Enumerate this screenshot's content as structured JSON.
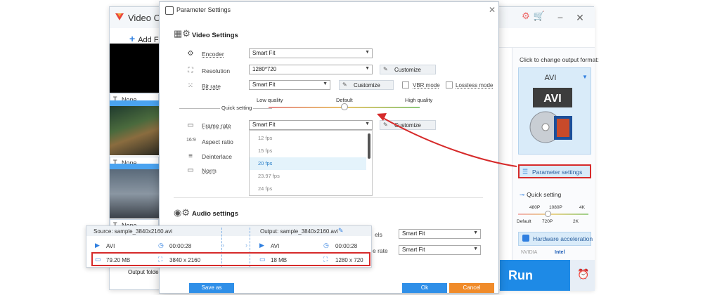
{
  "app": {
    "title": "Video Conv",
    "add_files": "Add File",
    "subtitle_rows": [
      {
        "icon": "T",
        "value": "None"
      },
      {
        "icon": "T",
        "value": "None"
      },
      {
        "icon": "T",
        "value": "None"
      }
    ],
    "output_folder_label": "Output folder:"
  },
  "right_panel": {
    "hint": "Click to change output format:",
    "format": "AVI",
    "format_badge": "AVI",
    "param_settings": "Parameter settings",
    "quick_setting": "Quick setting",
    "ticks_top": [
      "480P",
      "1080P",
      "4K"
    ],
    "ticks_bottom": [
      "Default",
      "720P",
      "2K"
    ],
    "hw_accel": "Hardware acceleration",
    "vendors": [
      "NVIDIA",
      "Intel"
    ],
    "run": "Run"
  },
  "dialog": {
    "title": "Parameter Settings",
    "video_section": "Video Settings",
    "audio_section": "Audio settings",
    "rows": {
      "encoder": {
        "label": "Encoder",
        "value": "Smart Fit"
      },
      "resolution": {
        "label": "Resolution",
        "value": "1280*720",
        "customize": "Customize"
      },
      "bitrate": {
        "label": "Bit rate",
        "value": "Smart Fit",
        "customize": "Customize",
        "vbr": "VBR mode",
        "lossless": "Lossless mode"
      },
      "framerate": {
        "label": "Frame rate",
        "value": "Smart Fit",
        "customize": "Customize"
      },
      "aspect": {
        "label": "Aspect ratio"
      },
      "deinterlace": {
        "label": "Deinterlace"
      },
      "norm": {
        "label": "Norm"
      }
    },
    "quick": {
      "label": "Quick setting",
      "low": "Low quality",
      "default": "Default",
      "high": "High quality"
    },
    "fps_options": [
      "12 fps",
      "15 fps",
      "20 fps",
      "23.97 fps",
      "24 fps"
    ],
    "fps_highlighted": "20 fps",
    "audio_rows": [
      {
        "label": "els",
        "value": "Smart Fit"
      },
      {
        "label": "e rate",
        "value": "Smart Fit"
      }
    ],
    "save_as": "Save as",
    "ok": "Ok",
    "cancel": "Cancel"
  },
  "info": {
    "source": "Source: sample_3840x2160.avi",
    "output": "Output: sample_3840x2160.avi",
    "src_format": "AVI",
    "src_duration": "00:00:28",
    "src_size": "79.20 MB",
    "src_resolution": "3840 x 2160",
    "out_format": "AVI",
    "out_duration": "00:00:28",
    "out_size": "18 MB",
    "out_resolution": "1280 x 720"
  },
  "colors": {
    "accent_blue": "#1e8ae6",
    "highlight_red": "#d62a2a",
    "cancel_orange": "#f08b2a"
  }
}
